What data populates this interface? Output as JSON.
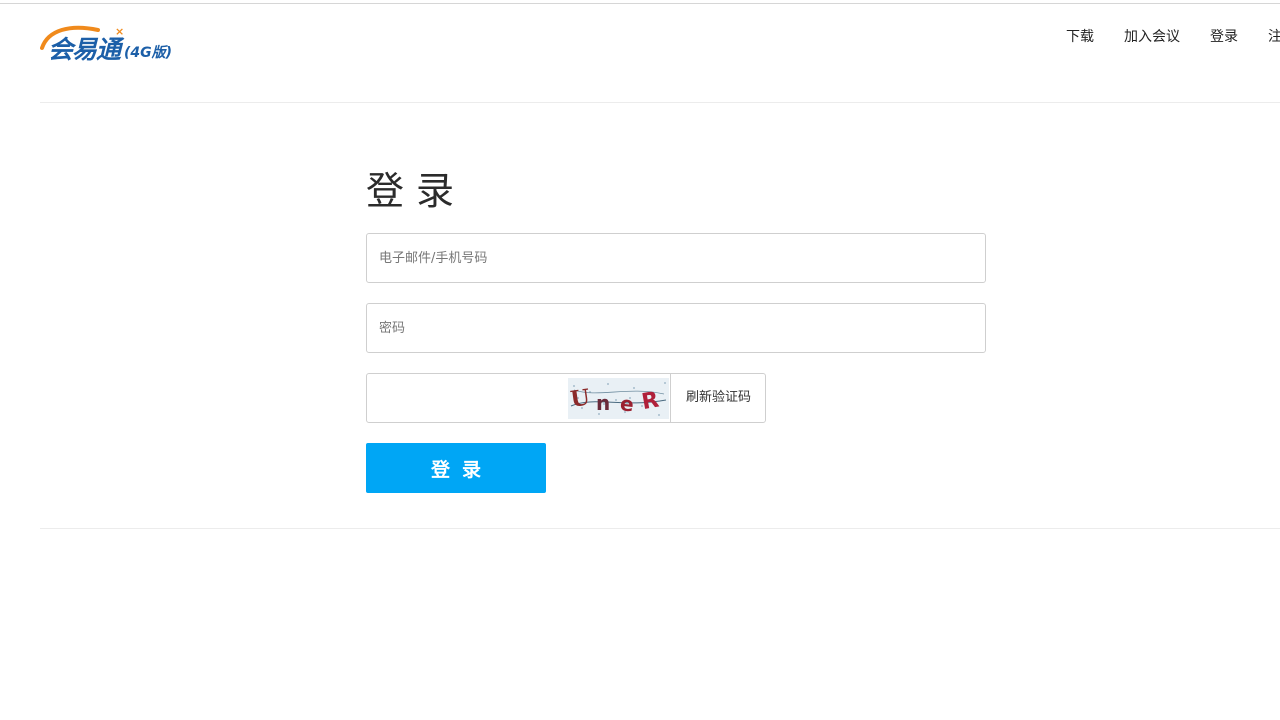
{
  "header": {
    "logo_text": "会易通",
    "logo_sub": "(4G版)",
    "nav": [
      {
        "label": "下载"
      },
      {
        "label": "加入会议"
      },
      {
        "label": "登录"
      },
      {
        "label": "注"
      }
    ]
  },
  "login": {
    "title": "登录",
    "email_placeholder": "电子邮件/手机号码",
    "password_placeholder": "密码",
    "captcha_text": "UneR",
    "refresh_captcha_label": "刷新验证码",
    "submit_label": "登录"
  },
  "colors": {
    "accent": "#00a6f5",
    "logo_blue": "#1c5fa8",
    "logo_orange": "#f08a1c"
  }
}
